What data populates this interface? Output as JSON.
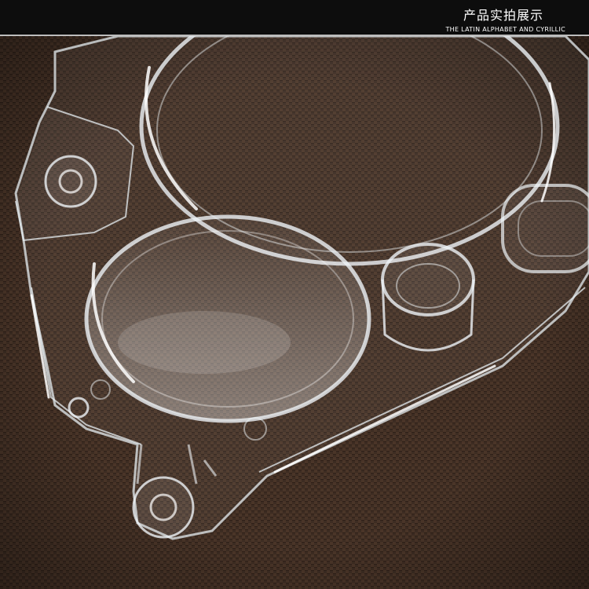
{
  "header": {
    "title_cn": "产品实拍展示",
    "subtitle_en": "THE LATIN ALPHABET AND CYRILLIC"
  },
  "photo": {
    "subject": "clear-plastic-gauge-cover",
    "background_color": "#3b2a20",
    "accent_color": "#e8eef2"
  }
}
